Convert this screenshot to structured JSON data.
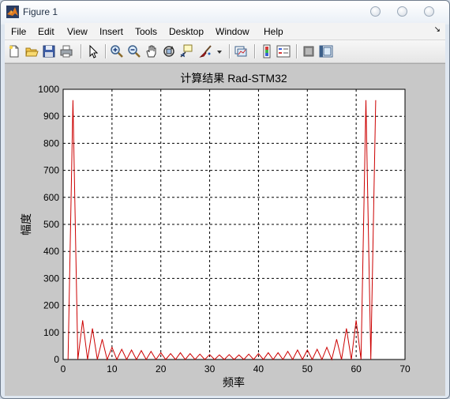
{
  "window": {
    "title": "Figure 1"
  },
  "menu": {
    "items": [
      "File",
      "Edit",
      "View",
      "Insert",
      "Tools",
      "Desktop",
      "Window",
      "Help"
    ],
    "overflow_arrow": "↘"
  },
  "toolbar": {
    "icons": [
      "new-figure-icon",
      "open-file-icon",
      "save-icon",
      "print-icon",
      "edit-plot-arrow-icon",
      "zoom-in-icon",
      "zoom-out-icon",
      "pan-hand-icon",
      "rotate-3d-icon",
      "data-cursor-icon",
      "brush-icon",
      "brush-dropdown-icon",
      "link-plot-icon",
      "insert-colorbar-icon",
      "insert-legend-icon",
      "hide-plot-tools-icon",
      "show-plot-tools-icon"
    ]
  },
  "colors": {
    "plot_line": "#cc0000",
    "figure_bg": "#c8c8c8",
    "axes_bg": "#ffffff"
  },
  "chart_data": {
    "type": "line",
    "title": "计算结果 Rad-STM32",
    "xlabel": "频率",
    "ylabel": "幅度",
    "xlim": [
      0,
      70
    ],
    "ylim": [
      0,
      1000
    ],
    "xticks": [
      0,
      10,
      20,
      30,
      40,
      50,
      60,
      70
    ],
    "yticks": [
      0,
      100,
      200,
      300,
      400,
      500,
      600,
      700,
      800,
      900,
      1000
    ],
    "grid": true,
    "grid_style": "dashed",
    "series": [
      {
        "x": [
          1,
          2,
          3,
          4,
          5,
          6,
          7,
          8,
          9,
          10,
          11,
          12,
          13,
          14,
          15,
          16,
          17,
          18,
          19,
          20,
          21,
          22,
          23,
          24,
          25,
          26,
          27,
          28,
          29,
          30,
          31,
          32,
          33,
          34,
          35,
          36,
          37,
          38,
          39,
          40,
          41,
          42,
          43,
          44,
          45,
          46,
          47,
          48,
          49,
          50,
          51,
          52,
          53,
          54,
          55,
          56,
          57,
          58,
          59,
          60,
          61,
          62,
          63,
          64
        ],
        "values": [
          0,
          960,
          0,
          145,
          0,
          115,
          0,
          75,
          0,
          45,
          0,
          38,
          0,
          35,
          0,
          33,
          0,
          30,
          0,
          25,
          0,
          22,
          0,
          25,
          0,
          22,
          0,
          20,
          0,
          18,
          0,
          17,
          0,
          18,
          0,
          17,
          0,
          20,
          0,
          22,
          0,
          25,
          0,
          25,
          0,
          30,
          0,
          35,
          0,
          35,
          0,
          38,
          0,
          45,
          0,
          75,
          0,
          115,
          0,
          145,
          0,
          960,
          0,
          960
        ]
      }
    ]
  }
}
